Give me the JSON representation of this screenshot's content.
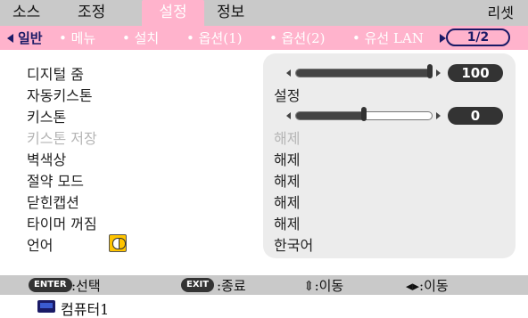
{
  "top_menu": {
    "items": [
      {
        "label": "소스"
      },
      {
        "label": "조정"
      },
      {
        "label": "설정"
      },
      {
        "label": "정보"
      }
    ],
    "active_index": 2,
    "reset_label": "리셋"
  },
  "tabs": {
    "items": [
      {
        "label": "일반"
      },
      {
        "label": "메뉴"
      },
      {
        "label": "설치"
      },
      {
        "label": "옵션(1)"
      },
      {
        "label": "옵션(2)"
      },
      {
        "label": "유선 LAN"
      }
    ],
    "active_index": 0,
    "page_indicator": "1/2"
  },
  "settings": {
    "digital_zoom": {
      "label": "디지털 줌",
      "value": "100",
      "level_percent": 100
    },
    "auto_keystone": {
      "label": "자동키스톤",
      "value": "설정"
    },
    "keystone": {
      "label": "키스톤",
      "value": "0",
      "level_percent": 50
    },
    "keystone_save": {
      "label": "키스톤 저장",
      "value": "해제",
      "disabled": true
    },
    "wall_color": {
      "label": "벽색상",
      "value": "해제"
    },
    "eco_mode": {
      "label": "절약 모드",
      "value": "해제"
    },
    "closed_caption": {
      "label": "닫힌캡션",
      "value": "해제"
    },
    "off_timer": {
      "label": "타이머 꺼짐",
      "value": "해제"
    },
    "language": {
      "label": "언어",
      "value": "한국어",
      "icon": "language-icon"
    }
  },
  "help": {
    "enter_key": "ENTER",
    "enter_text": ":선택",
    "exit_key": "EXIT",
    "exit_text": ":종료",
    "updown_text": "⇕:이동",
    "leftright_text": "◂▸:이동"
  },
  "source": {
    "icon": "computer-monitor-icon",
    "label": "컴퓨터1"
  },
  "colors": {
    "accent_pink": "#ffb3cc",
    "bar_gray": "#c9c9c9",
    "panel_gray": "#ececec",
    "dark_text": "#1a1a66"
  }
}
